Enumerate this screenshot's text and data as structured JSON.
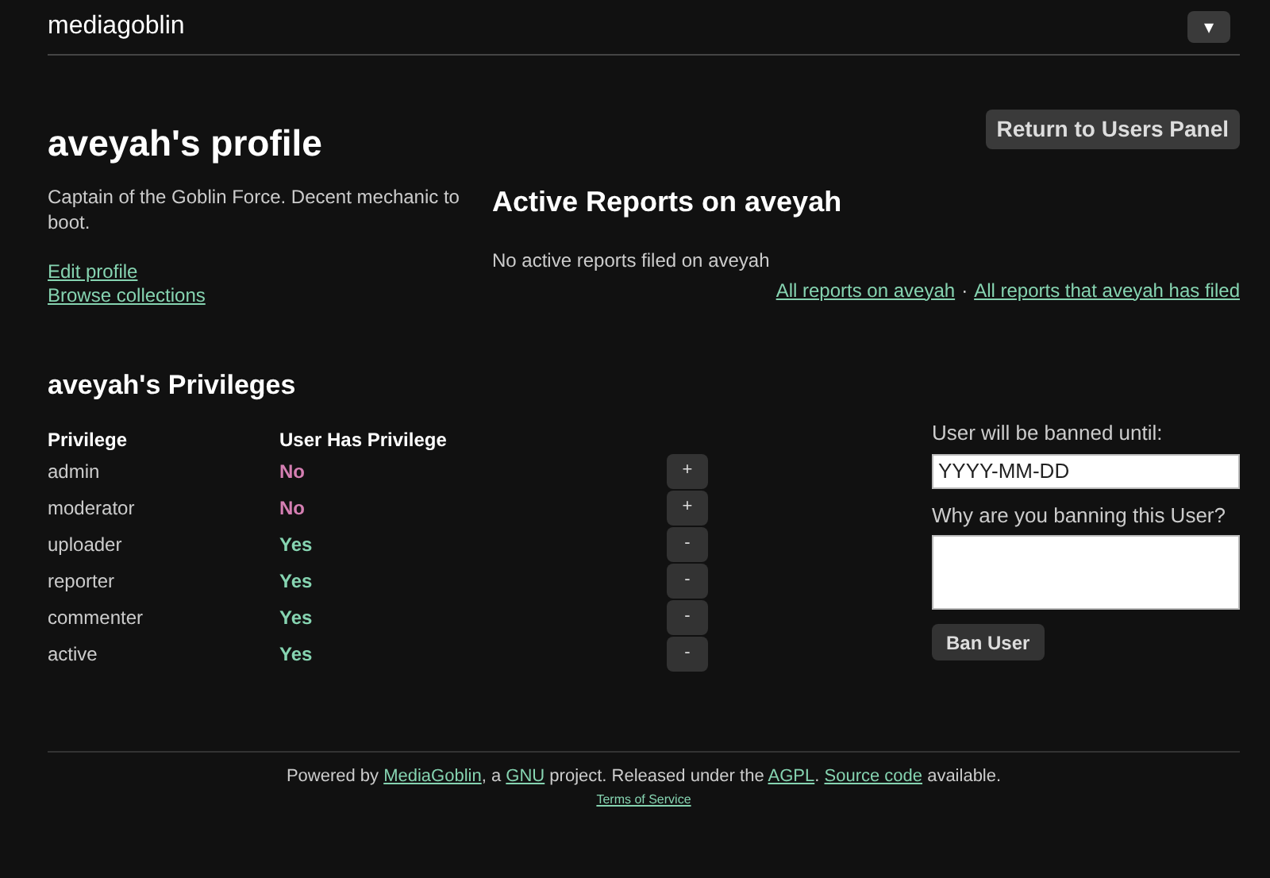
{
  "header": {
    "logo": "mediagoblin",
    "menu_toggle": "▾"
  },
  "profile": {
    "title": "aveyah's profile",
    "return_button": "Return to Users Panel",
    "bio": "Captain of the Goblin Force. Decent mechanic to boot.",
    "links": [
      "Edit profile",
      "Browse collections"
    ]
  },
  "reports": {
    "title": "Active Reports on aveyah",
    "empty_message": "No active reports filed on aveyah",
    "links": [
      "All reports on aveyah",
      "All reports that aveyah has filed"
    ],
    "separator": "·"
  },
  "privileges": {
    "title": "aveyah's Privileges",
    "columns": [
      "Privilege",
      "User Has Privilege"
    ],
    "rows": [
      {
        "name": "admin",
        "value": "No",
        "has": false,
        "action": "+"
      },
      {
        "name": "moderator",
        "value": "No",
        "has": false,
        "action": "+"
      },
      {
        "name": "uploader",
        "value": "Yes",
        "has": true,
        "action": "-"
      },
      {
        "name": "reporter",
        "value": "Yes",
        "has": true,
        "action": "-"
      },
      {
        "name": "commenter",
        "value": "Yes",
        "has": true,
        "action": "-"
      },
      {
        "name": "active",
        "value": "Yes",
        "has": true,
        "action": "-"
      }
    ]
  },
  "ban_form": {
    "until_label": "User will be banned until:",
    "until_placeholder": "YYYY-MM-DD",
    "reason_label": "Why are you banning this User?",
    "submit": "Ban User"
  },
  "footer": {
    "segments": [
      {
        "kind": "text",
        "text": "Powered by "
      },
      {
        "kind": "link",
        "text": "MediaGoblin"
      },
      {
        "kind": "text",
        "text": ", a "
      },
      {
        "kind": "link",
        "text": "GNU"
      },
      {
        "kind": "text",
        "text": " project. Released under the "
      },
      {
        "kind": "link",
        "text": "AGPL"
      },
      {
        "kind": "text",
        "text": ". "
      },
      {
        "kind": "link",
        "text": "Source code"
      },
      {
        "kind": "text",
        "text": " available."
      }
    ],
    "terms": "Terms of Service"
  }
}
